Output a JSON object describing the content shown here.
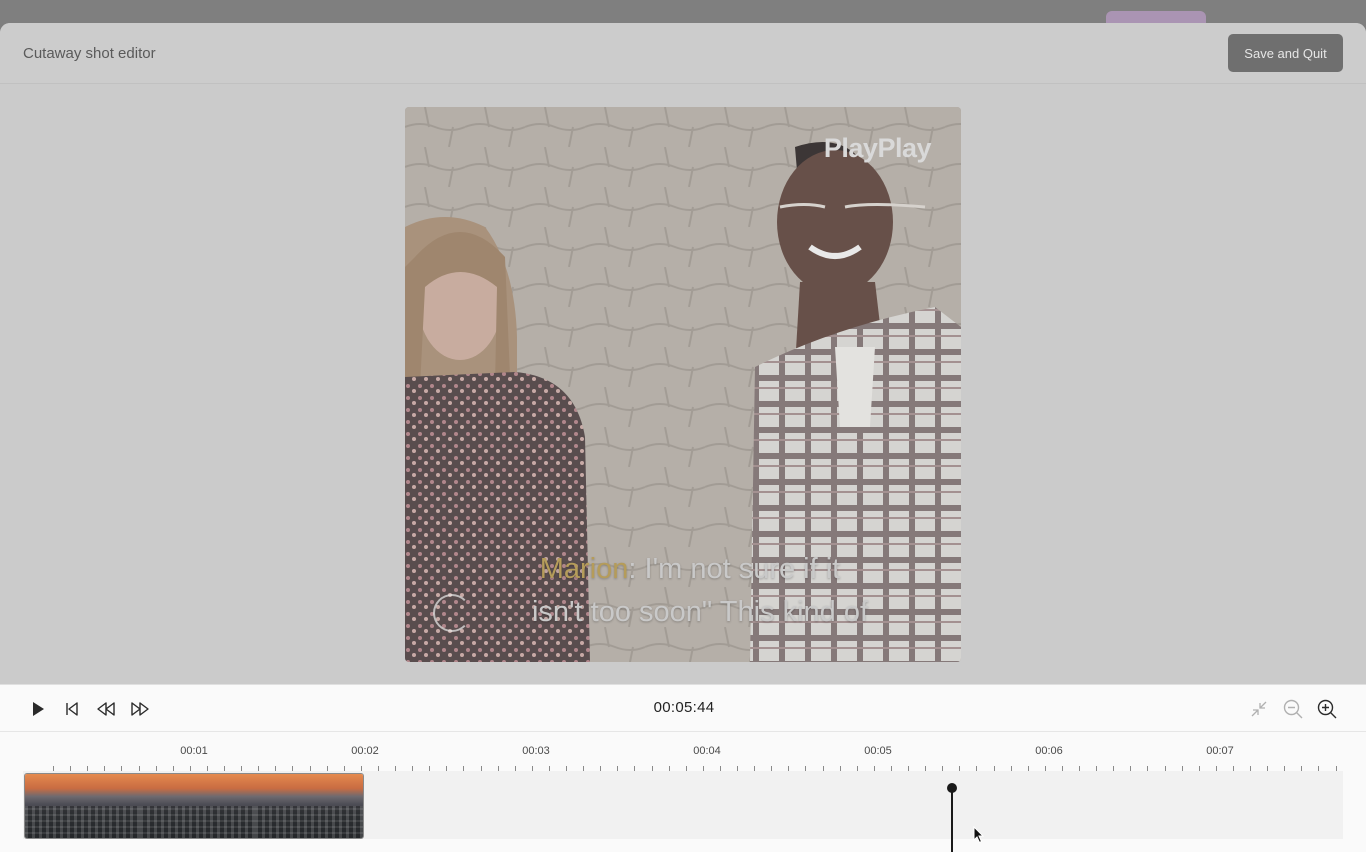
{
  "app": {
    "title": "Cutaway shot editor",
    "save_button": "Save and Quit"
  },
  "preview": {
    "watermark": "PlayPlay",
    "caption_speaker": "Marion",
    "caption_line1_rest": ": I'm not sure if it",
    "caption_line2": "isn't too soon\" This kind of"
  },
  "player": {
    "timecode": "00:05:44",
    "icons": [
      "play-icon",
      "skip-to-start-icon",
      "rewind-icon",
      "fast-forward-icon",
      "shrink-icon",
      "zoom-out-icon",
      "zoom-in-icon"
    ]
  },
  "timeline": {
    "labels": [
      "00:01",
      "00:02",
      "00:03",
      "00:04",
      "00:05",
      "00:06",
      "00:07"
    ]
  },
  "colors": {
    "overlay": "#cbcbcb",
    "button": "#6f6f6f",
    "speaker": "#b59c5a",
    "panel": "#fafafa"
  }
}
